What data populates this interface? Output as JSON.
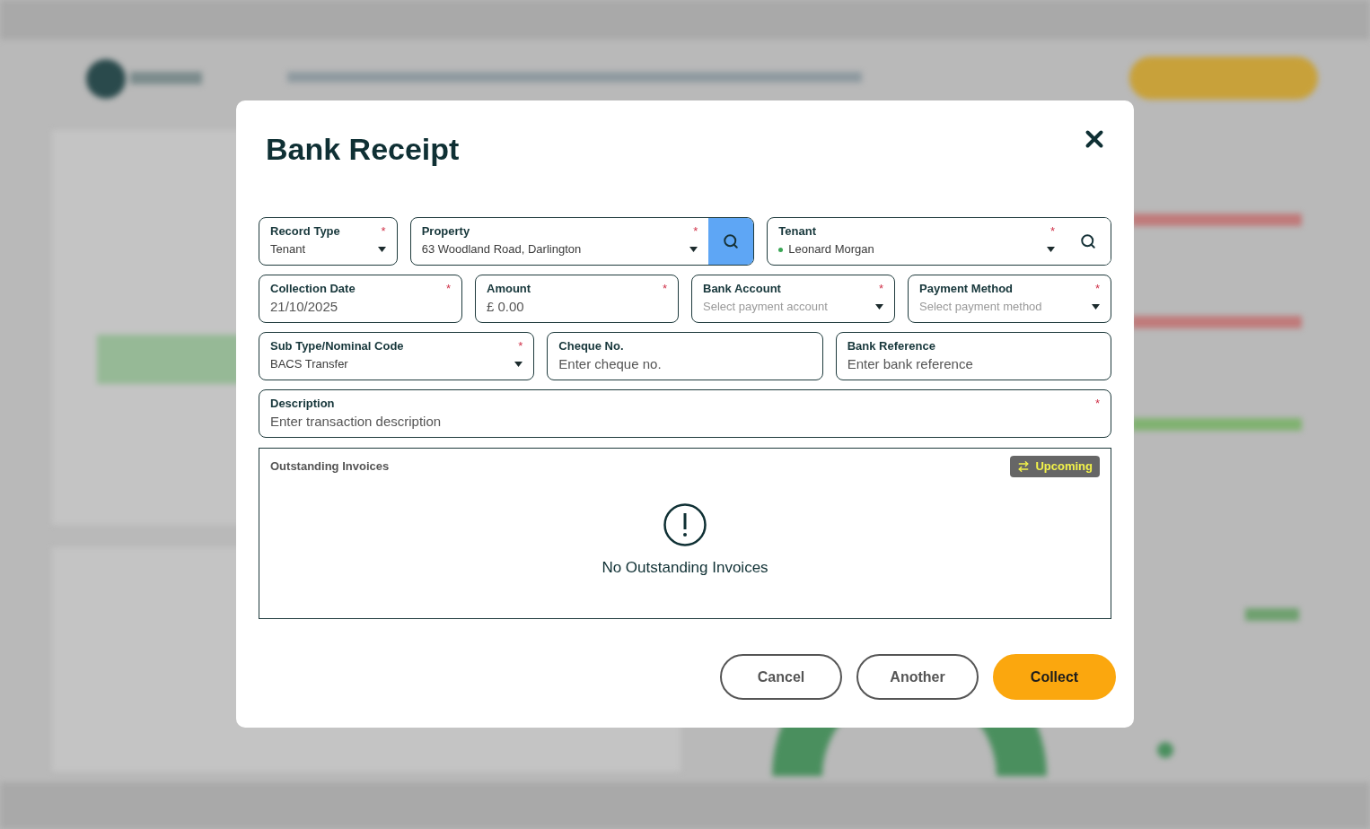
{
  "dialog": {
    "title": "Bank Receipt",
    "field_rows": [
      [
        {
          "kind": "select",
          "label": "Record Type",
          "required_mark": "*",
          "value": "Tenant"
        },
        {
          "kind": "select",
          "label": "Property",
          "required_mark": "*",
          "value": "63 Woodland Road, Darlington",
          "search": true,
          "search_highlighted": true
        },
        {
          "kind": "select",
          "label": "Tenant",
          "required_mark": "*",
          "value": "Leonard Morgan",
          "color": "#3aa655",
          "search": true,
          "search_highlighted": false
        }
      ],
      [
        {
          "kind": "text",
          "label": "Collection Date",
          "required_mark": "*",
          "value": "21/10/2025"
        },
        {
          "kind": "text",
          "label": "Amount",
          "required_mark": "*",
          "value": "£ 0.00"
        },
        {
          "kind": "select",
          "label": "Bank Account",
          "required_mark": "*",
          "placeholder": "Select payment account"
        },
        {
          "kind": "select",
          "label": "Payment Method",
          "required_mark": "*",
          "placeholder": "Select payment method"
        }
      ],
      [
        {
          "kind": "select",
          "label": "Sub Type/Nominal Code",
          "required_mark": "*",
          "value": "BACS Transfer"
        },
        {
          "kind": "text",
          "label": "Cheque No.",
          "placeholder": "Enter cheque no."
        },
        {
          "kind": "text",
          "label": "Bank Reference",
          "placeholder": "Enter bank reference"
        }
      ],
      [
        {
          "kind": "text",
          "label": "Description",
          "required_mark": "*",
          "placeholder": "Enter transaction description"
        }
      ]
    ],
    "invoices": {
      "title": "Outstanding Invoices",
      "toggle": "Upcoming",
      "empty_message": "No Outstanding Invoices"
    },
    "buttons": [
      {
        "label": "Cancel",
        "kind": "outline"
      },
      {
        "label": "Another",
        "kind": "outline"
      },
      {
        "label": "Collect",
        "kind": "primary"
      }
    ]
  }
}
